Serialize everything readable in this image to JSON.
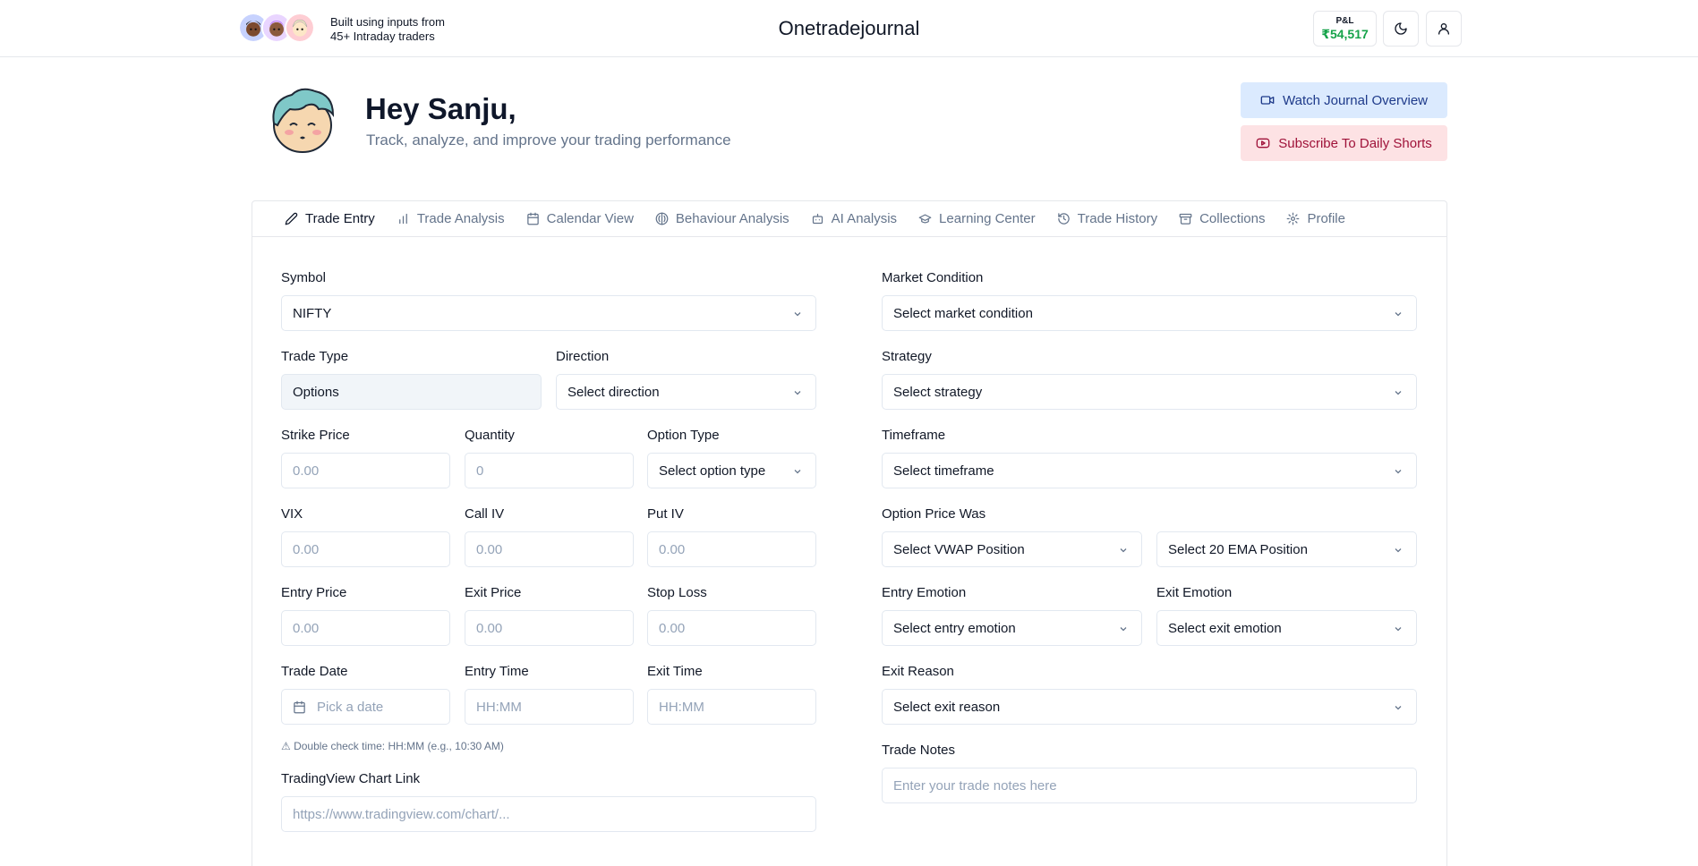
{
  "header": {
    "built_line1": "Built using inputs from",
    "built_line2": "45+ Intraday traders",
    "brand": "Onetradejournal",
    "pnl_label": "P&L",
    "pnl_value": "₹54,517",
    "pnl_color": "#16a34a",
    "theme_icon": "moon-icon",
    "profile_icon": "user-icon"
  },
  "hero": {
    "greeting": "Hey Sanju,",
    "subtitle": "Track, analyze, and improve your trading performance",
    "watch_label": "Watch Journal Overview",
    "subscribe_label": "Subscribe To Daily Shorts"
  },
  "tabs": [
    {
      "label": "Trade Entry",
      "icon": "pencil-icon",
      "active": true
    },
    {
      "label": "Trade Analysis",
      "icon": "bar-chart-icon"
    },
    {
      "label": "Calendar View",
      "icon": "calendar-icon"
    },
    {
      "label": "Behaviour Analysis",
      "icon": "brain-icon"
    },
    {
      "label": "AI Analysis",
      "icon": "bot-icon"
    },
    {
      "label": "Learning Center",
      "icon": "graduation-cap-icon"
    },
    {
      "label": "Trade History",
      "icon": "history-icon"
    },
    {
      "label": "Collections",
      "icon": "archive-icon"
    },
    {
      "label": "Profile",
      "icon": "gear-icon"
    }
  ],
  "form": {
    "symbol": {
      "label": "Symbol",
      "value": "NIFTY"
    },
    "trade_type": {
      "label": "Trade Type",
      "value": "Options"
    },
    "direction": {
      "label": "Direction",
      "placeholder": "Select direction"
    },
    "strike_price": {
      "label": "Strike Price",
      "placeholder": "0.00"
    },
    "quantity": {
      "label": "Quantity",
      "placeholder": "0"
    },
    "option_type": {
      "label": "Option Type",
      "placeholder": "Select option type"
    },
    "vix": {
      "label": "VIX",
      "placeholder": "0.00"
    },
    "call_iv": {
      "label": "Call IV",
      "placeholder": "0.00"
    },
    "put_iv": {
      "label": "Put IV",
      "placeholder": "0.00"
    },
    "entry_price": {
      "label": "Entry Price",
      "placeholder": "0.00"
    },
    "exit_price": {
      "label": "Exit Price",
      "placeholder": "0.00"
    },
    "stop_loss": {
      "label": "Stop Loss",
      "placeholder": "0.00"
    },
    "trade_date": {
      "label": "Trade Date",
      "placeholder": "Pick a date"
    },
    "entry_time": {
      "label": "Entry Time",
      "placeholder": "HH:MM"
    },
    "exit_time": {
      "label": "Exit Time",
      "placeholder": "HH:MM"
    },
    "time_hint": "⚠ Double check time: HH:MM (e.g., 10:30 AM)",
    "chart_link": {
      "label": "TradingView Chart Link",
      "placeholder": "https://www.tradingview.com/chart/..."
    },
    "market_condition": {
      "label": "Market Condition",
      "placeholder": "Select market condition"
    },
    "strategy": {
      "label": "Strategy",
      "placeholder": "Select strategy"
    },
    "timeframe": {
      "label": "Timeframe",
      "placeholder": "Select timeframe"
    },
    "option_price_was": {
      "label": "Option Price Was",
      "vwap_placeholder": "Select VWAP Position",
      "ema_placeholder": "Select 20 EMA Position"
    },
    "entry_emotion": {
      "label": "Entry Emotion",
      "placeholder": "Select entry emotion"
    },
    "exit_emotion": {
      "label": "Exit Emotion",
      "placeholder": "Select exit emotion"
    },
    "exit_reason": {
      "label": "Exit Reason",
      "placeholder": "Select exit reason"
    },
    "trade_notes": {
      "label": "Trade Notes",
      "placeholder": "Enter your trade notes here"
    }
  }
}
